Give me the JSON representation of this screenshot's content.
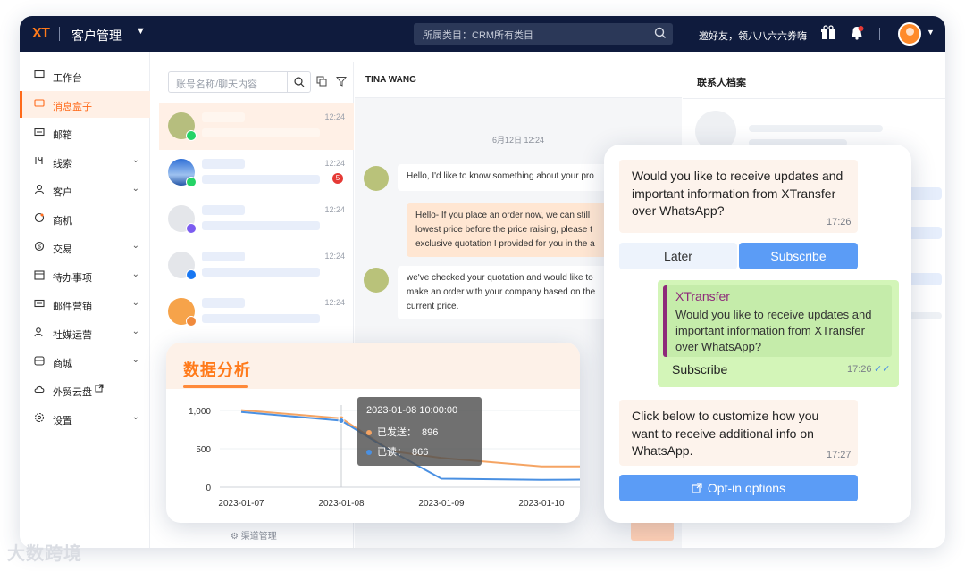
{
  "topbar": {
    "logo": "XT",
    "app_title": "客户管理",
    "search_placeholder": "所属类目：CRM所有类目",
    "invite": "邀好友，领八八六六券嗨"
  },
  "sidebar": {
    "items": [
      {
        "label": "工作台",
        "icon": "monitor-icon"
      },
      {
        "label": "消息盒子",
        "icon": "chat-box-icon"
      },
      {
        "label": "邮箱",
        "icon": "mail-icon"
      },
      {
        "label": "线索",
        "icon": "leads-icon"
      },
      {
        "label": "客户",
        "icon": "customer-icon"
      },
      {
        "label": "商机",
        "icon": "opportunity-icon"
      },
      {
        "label": "交易",
        "icon": "transaction-icon"
      },
      {
        "label": "待办事项",
        "icon": "calendar-icon"
      },
      {
        "label": "邮件营销",
        "icon": "email-marketing-icon"
      },
      {
        "label": "社媒运营",
        "icon": "social-icon"
      },
      {
        "label": "商城",
        "icon": "store-icon"
      },
      {
        "label": "外贸云盘",
        "icon": "cloud-icon"
      },
      {
        "label": "设置",
        "icon": "settings-icon"
      }
    ]
  },
  "list": {
    "search_placeholder": "账号名称/聊天内容",
    "conversations": [
      {
        "time": "12:24",
        "channel": "whatsapp",
        "unread": ""
      },
      {
        "time": "12:24",
        "channel": "whatsapp",
        "unread": "5"
      },
      {
        "time": "12:24",
        "channel": "messenger",
        "unread": ""
      },
      {
        "time": "12:24",
        "channel": "facebook",
        "unread": ""
      },
      {
        "time": "12:24",
        "channel": "other",
        "unread": ""
      }
    ],
    "channel_manage": "渠道管理"
  },
  "chat": {
    "contact_name": "TINA WANG",
    "date_label": "6月12日 12:24",
    "messages": [
      {
        "dir": "in",
        "text": "Hello, I'd like to know something about your pro"
      },
      {
        "dir": "out",
        "text": "Hello- If you place an order now, we can still\nlowest price before the price raising, please t\nexclusive quotation I provided for you in the a"
      },
      {
        "dir": "in",
        "text": "we've checked your quotation and would like to\nmake an order with your company based on the\ncurrent price."
      }
    ]
  },
  "profile": {
    "title": "联系人档案"
  },
  "analysis": {
    "title": "数据分析",
    "tooltip": {
      "date": "2023-01-08 10:00:00",
      "sent_label": "已发送：",
      "sent_value": "896",
      "read_label": "已读：",
      "read_value": "866"
    }
  },
  "chart_data": {
    "type": "line",
    "x": [
      "2023-01-07",
      "2023-01-08",
      "2023-01-09",
      "2023-01-10"
    ],
    "yticks": [
      "0",
      "500",
      "1,000"
    ],
    "ylim": [
      0,
      1000
    ],
    "series": [
      {
        "name": "已发送",
        "color": "#f5a463",
        "points": [
          [
            0,
            1005
          ],
          [
            1,
            896
          ],
          [
            1.5,
            470
          ],
          [
            2,
            380
          ],
          [
            3,
            270
          ],
          [
            3.5,
            270
          ]
        ]
      },
      {
        "name": "已读",
        "color": "#4a90e2",
        "points": [
          [
            0,
            980
          ],
          [
            1,
            866
          ],
          [
            1.5,
            470
          ],
          [
            2,
            110
          ],
          [
            3,
            95
          ],
          [
            3.5,
            100
          ]
        ]
      }
    ]
  },
  "whatsapp": {
    "msg1": "Would you like to receive updates and important information from XTransfer over WhatsApp?",
    "msg1_time": "17:26",
    "later": "Later",
    "subscribe": "Subscribe",
    "quote_title": "XTransfer",
    "quote_body": "Would you like to receive updates and important information from XTransfer over WhatsApp?",
    "reply": "Subscribe",
    "reply_time": "17:26",
    "msg2": "Click below to customize how you want to receive additional info on WhatsApp.",
    "msg2_time": "17:27",
    "optin": "Opt-in options",
    "colors": {
      "green": "#d3f5b8",
      "button_blue": "#5b9cf6",
      "later_bg": "#edf3fc"
    }
  },
  "watermark": "大数跨境"
}
